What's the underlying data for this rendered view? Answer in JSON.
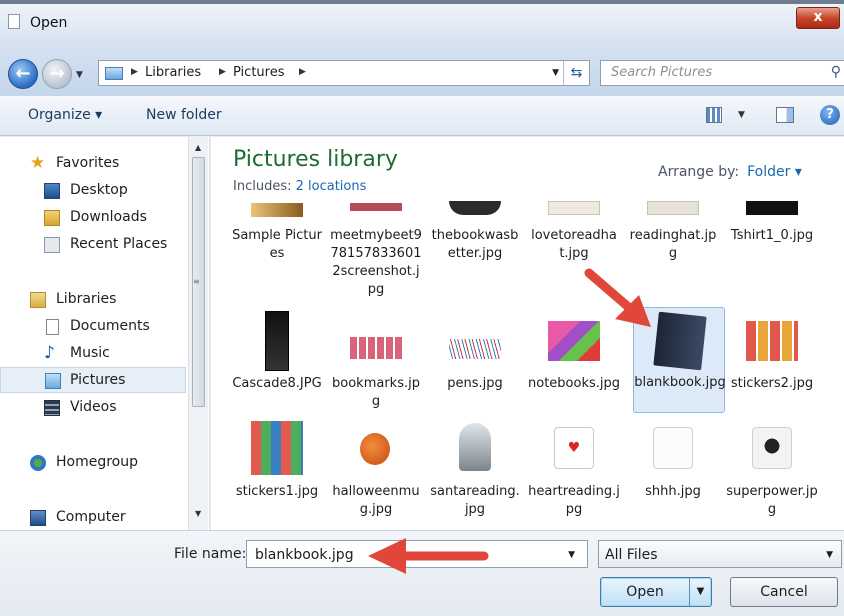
{
  "window": {
    "title": "Open"
  },
  "close_glyph": "x",
  "nav": {
    "breadcrumb": [
      "Libraries",
      "Pictures"
    ],
    "search_placeholder": "Search Pictures"
  },
  "toolbar": {
    "organize": "Organize ▾",
    "new_folder": "New folder"
  },
  "sidebar": {
    "items": [
      {
        "label": "Favorites",
        "icon": "star-icon"
      },
      {
        "label": "Desktop",
        "icon": "desktop-icon"
      },
      {
        "label": "Downloads",
        "icon": "downloads-icon"
      },
      {
        "label": "Recent Places",
        "icon": "recent-places-icon"
      },
      {
        "label": "Libraries",
        "icon": "libraries-icon"
      },
      {
        "label": "Documents",
        "icon": "documents-icon"
      },
      {
        "label": "Music",
        "icon": "music-icon"
      },
      {
        "label": "Pictures",
        "icon": "pictures-icon",
        "selected": true
      },
      {
        "label": "Videos",
        "icon": "videos-icon"
      },
      {
        "label": "Homegroup",
        "icon": "homegroup-icon"
      },
      {
        "label": "Computer",
        "icon": "computer-icon"
      }
    ]
  },
  "content": {
    "title": "Pictures library",
    "includes_prefix": "Includes:",
    "includes_link": "2 locations",
    "arrange_label": "Arrange by:",
    "arrange_value": "Folder ▾",
    "files": [
      {
        "name": "Sample Pictures"
      },
      {
        "name": "meetmybeet9781578336012screenshot.jpg"
      },
      {
        "name": "thebookwasbetter.jpg"
      },
      {
        "name": "lovetoreadhat.jpg"
      },
      {
        "name": "readinghat.jpg"
      },
      {
        "name": "Tshirt1_0.jpg"
      },
      {
        "name": "Cascade8.JPG"
      },
      {
        "name": "bookmarks.jpg"
      },
      {
        "name": "pens.jpg"
      },
      {
        "name": "notebooks.jpg"
      },
      {
        "name": "blankbook.jpg",
        "selected": true
      },
      {
        "name": "stickers2.jpg"
      },
      {
        "name": "stickers1.jpg"
      },
      {
        "name": "halloweenmug.jpg"
      },
      {
        "name": "santareading.jpg"
      },
      {
        "name": "heartreading.jpg"
      },
      {
        "name": "shhh.jpg"
      },
      {
        "name": "superpower.jpg"
      }
    ]
  },
  "footer": {
    "file_name_label": "File name:",
    "file_name_value": "blankbook.jpg",
    "filter_value": "All Files",
    "open_label": "Open",
    "cancel_label": "Cancel"
  },
  "colors": {
    "accent_arrow": "#e0463a",
    "library_title": "#1e6b34",
    "link": "#1a66b3"
  }
}
